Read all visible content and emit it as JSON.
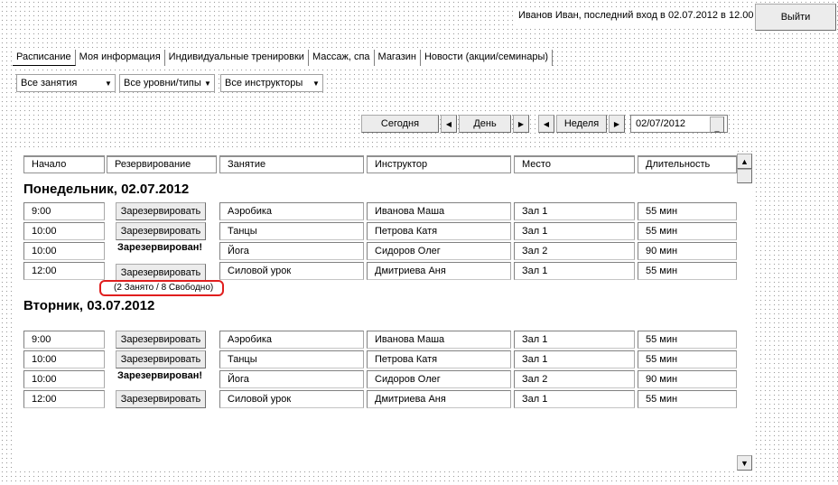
{
  "header": {
    "user_info": "Иванов Иван, последний вход в 02.07.2012 в 12.00",
    "logout_label": "Выйти"
  },
  "tabs": [
    "Расписание",
    "Моя информация",
    "Индивидуальные тренировки",
    "Массаж, спа",
    "Магазин",
    "Новости (акции/семинары)"
  ],
  "filters": {
    "classes": "Все занятия",
    "levels": "Все уровни/типы",
    "instructors": "Все инструкторы"
  },
  "nav": {
    "today": "Сегодня",
    "day": "День",
    "week": "Неделя",
    "date": "02/07/2012"
  },
  "columns": [
    "Начало",
    "Резервирование",
    "Занятие",
    "Инструктор",
    "Место",
    "Длительность"
  ],
  "labels": {
    "reserve": "Зарезервировать",
    "reserved": "Зарезервирован!",
    "occupancy": "(2 Занято / 8 Свободно)"
  },
  "days": [
    {
      "title": "Понедельник, 02.07.2012",
      "rows": [
        {
          "start": "9:00",
          "class": "Аэробика",
          "instructor": "Иванова Маша",
          "place": "Зал 1",
          "duration": "55 мин"
        },
        {
          "start": "10:00",
          "class": "Танцы",
          "instructor": "Петрова Катя",
          "place": "Зал 1",
          "duration": "55 мин"
        },
        {
          "start": "10:00",
          "class": "Йога",
          "instructor": "Сидоров Олег",
          "place": "Зал 2",
          "duration": "90 мин"
        },
        {
          "start": "12:00",
          "class": "Силовой урок",
          "instructor": "Дмитриева Аня",
          "place": "Зал 1",
          "duration": "55 мин"
        }
      ]
    },
    {
      "title": "Вторник, 03.07.2012",
      "rows": [
        {
          "start": "9:00",
          "class": "Аэробика",
          "instructor": "Иванова Маша",
          "place": "Зал 1",
          "duration": "55 мин"
        },
        {
          "start": "10:00",
          "class": "Танцы",
          "instructor": "Петрова Катя",
          "place": "Зал 1",
          "duration": "55 мин"
        },
        {
          "start": "10:00",
          "class": "Йога",
          "instructor": "Сидоров Олег",
          "place": "Зал 2",
          "duration": "90 мин"
        },
        {
          "start": "12:00",
          "class": "Силовой урок",
          "instructor": "Дмитриева Аня",
          "place": "Зал 1",
          "duration": "55 мин"
        }
      ]
    }
  ]
}
